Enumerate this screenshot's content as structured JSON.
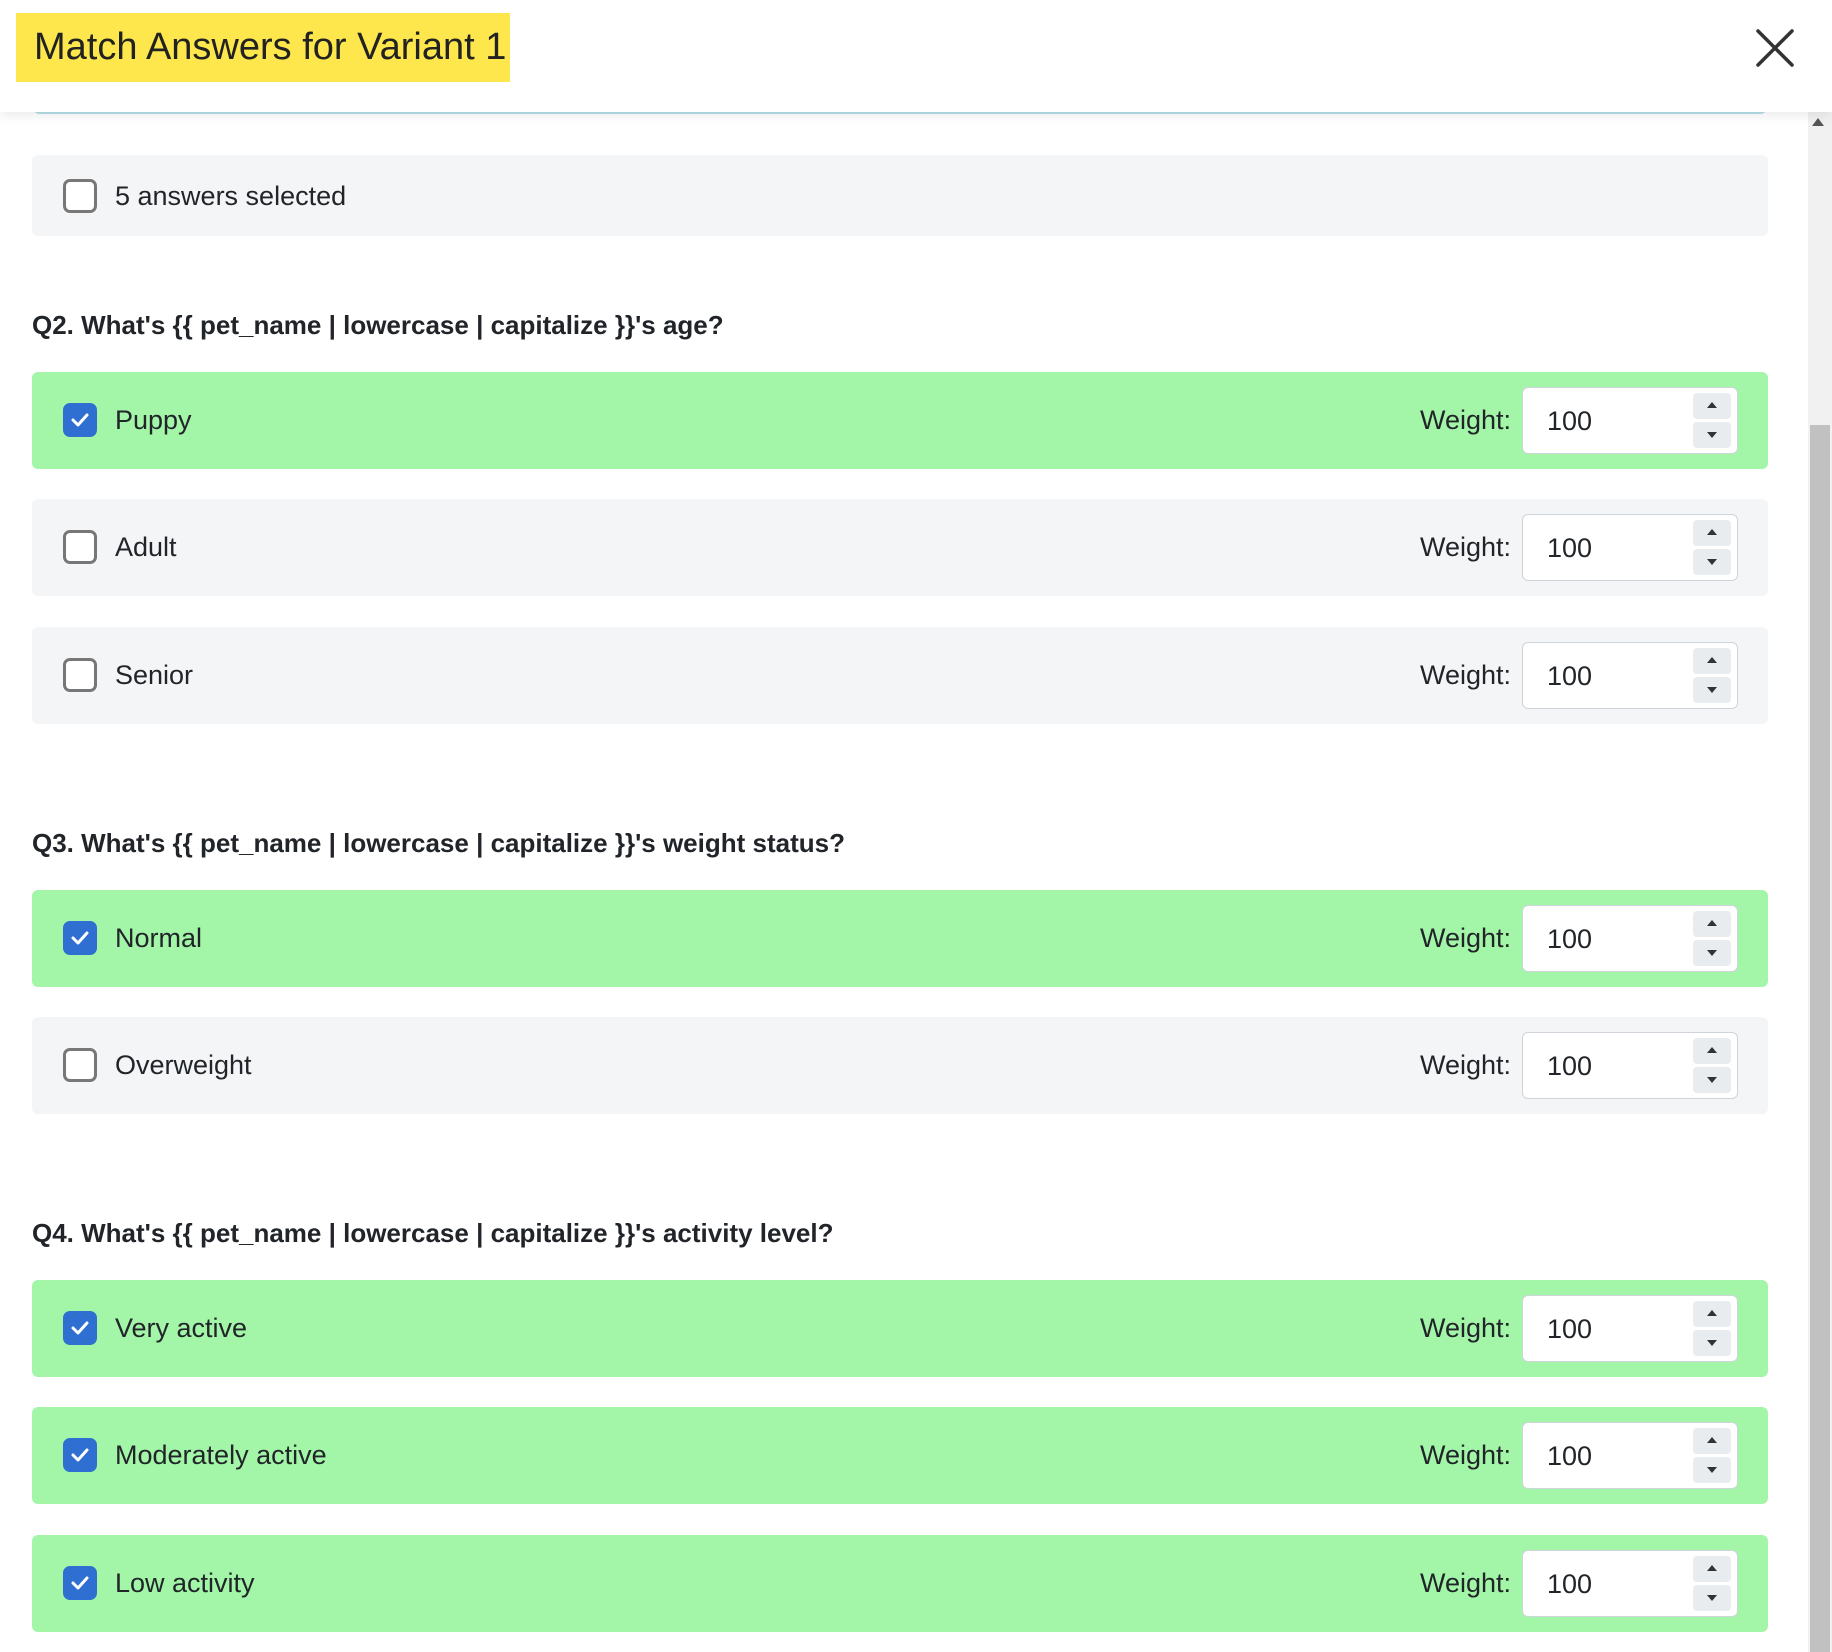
{
  "modal": {
    "title": "Match Answers for Variant 1",
    "close_icon": "close-icon"
  },
  "summary": {
    "label": "5 answers selected",
    "checked": false
  },
  "weight_label": "Weight:",
  "questions": [
    {
      "title": "Q2. What's {{ pet_name | lowercase | capitalize }}'s age?",
      "answers": [
        {
          "label": "Puppy",
          "checked": true,
          "weight": "100"
        },
        {
          "label": "Adult",
          "checked": false,
          "weight": "100"
        },
        {
          "label": "Senior",
          "checked": false,
          "weight": "100"
        }
      ]
    },
    {
      "title": "Q3. What's {{ pet_name | lowercase | capitalize }}'s weight status?",
      "answers": [
        {
          "label": "Normal",
          "checked": true,
          "weight": "100"
        },
        {
          "label": "Overweight",
          "checked": false,
          "weight": "100"
        }
      ]
    },
    {
      "title": "Q4. What's {{ pet_name | lowercase | capitalize }}'s activity level?",
      "answers": [
        {
          "label": "Very active",
          "checked": true,
          "weight": "100"
        },
        {
          "label": "Moderately active",
          "checked": true,
          "weight": "100"
        },
        {
          "label": "Low activity",
          "checked": true,
          "weight": "100"
        }
      ]
    }
  ],
  "colors": {
    "title_highlight": "#fde74c",
    "selected_row": "#a3f6a8",
    "unselected_row": "#f4f5f7",
    "checkbox_checked": "#2f6fd1"
  }
}
